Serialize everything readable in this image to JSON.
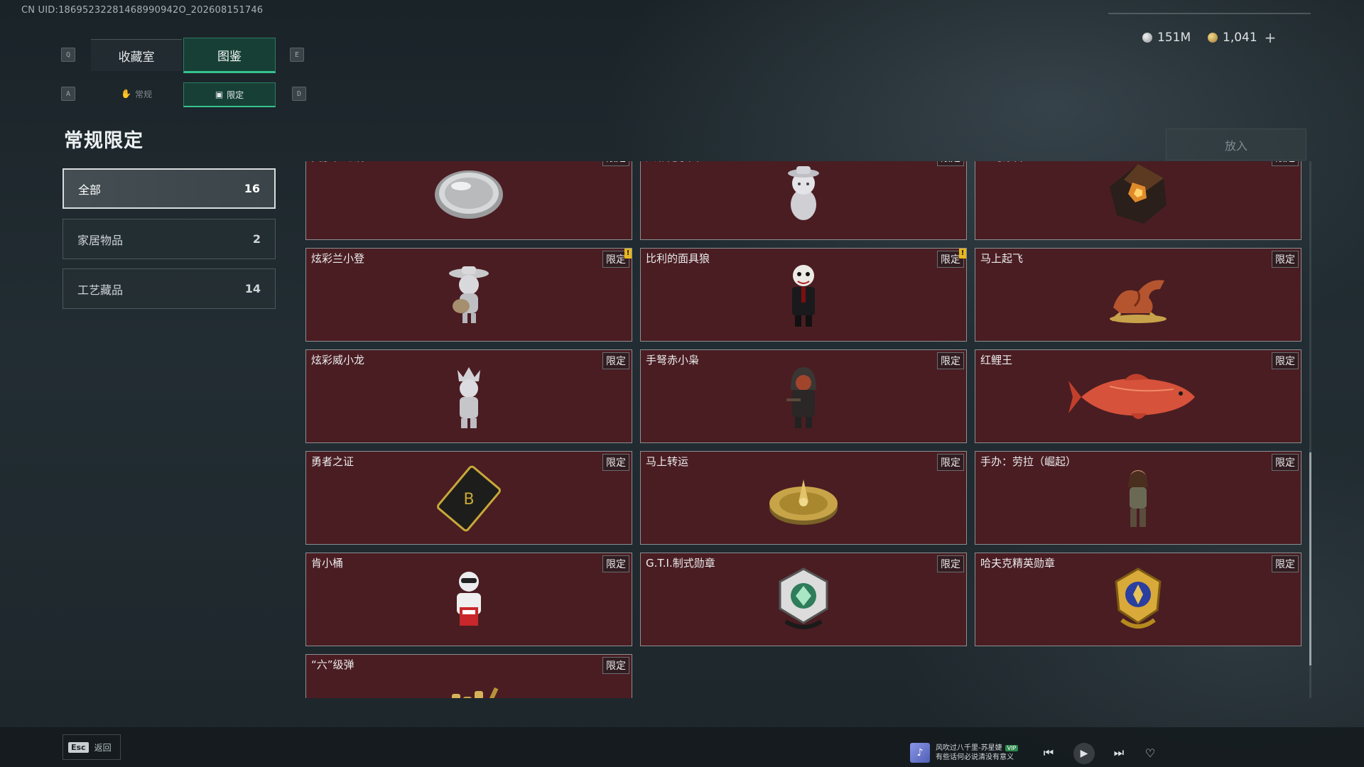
{
  "uid": "CN UID:18695232281468990942O_202608151746",
  "currency": {
    "silver": "151M",
    "gold": "1,041",
    "plus": "+"
  },
  "keys": {
    "prev_tab": "Q",
    "next_tab": "E",
    "prev_sub": "A",
    "next_sub": "D"
  },
  "tabs": [
    {
      "label": "收藏室"
    },
    {
      "label": "图鉴"
    }
  ],
  "subtabs": [
    {
      "label": "常规",
      "icon": "hand-icon"
    },
    {
      "label": "限定",
      "icon": "picture-icon"
    }
  ],
  "page_title": "常规限定",
  "put_button": "放入",
  "filters": [
    {
      "label": "全部",
      "count": "16"
    },
    {
      "label": "家居物品",
      "count": "2"
    },
    {
      "label": "工艺藏品",
      "count": "14"
    }
  ],
  "items": [
    {
      "name": "美彦祖之镜",
      "tag": "限定",
      "art": "mirror"
    },
    {
      "name": "炫彩兔小圈",
      "tag": "限定",
      "art": "bunny"
    },
    {
      "name": "至纯源石",
      "tag": "限定",
      "art": "stone"
    },
    {
      "name": "炫彩兰小登",
      "tag": "限定",
      "art": "guitar",
      "new": "!"
    },
    {
      "name": "比利的面具狼",
      "tag": "限定",
      "art": "puppet",
      "new": "!"
    },
    {
      "name": "马上起飞",
      "tag": "限定",
      "art": "horse"
    },
    {
      "name": "炫彩威小龙",
      "tag": "限定",
      "art": "crown"
    },
    {
      "name": "手弩赤小枭",
      "tag": "限定",
      "art": "hooded"
    },
    {
      "name": "红鲤王",
      "tag": "限定",
      "art": "carp"
    },
    {
      "name": "勇者之证",
      "tag": "限定",
      "art": "card"
    },
    {
      "name": "马上转运",
      "tag": "限定",
      "art": "disc"
    },
    {
      "name": "手办：劳拉（崛起）",
      "tag": "限定",
      "art": "lara"
    },
    {
      "name": "肯小桶",
      "tag": "限定",
      "art": "colonel"
    },
    {
      "name": "G.T.I.制式勋章",
      "tag": "限定",
      "art": "gti"
    },
    {
      "name": "哈夫克精英勋章",
      "tag": "限定",
      "art": "haf"
    },
    {
      "name": "“六”级弹",
      "tag": "限定",
      "art": "bullets"
    }
  ],
  "footer": {
    "esc_key": "Esc",
    "esc_label": "返回"
  },
  "music": {
    "line1": "风吹过八千里-苏星婕",
    "vip": "VIP",
    "line2": "有些话何必说清没有意义"
  },
  "colors": {
    "accent": "#36c38f",
    "card_bg": "#4a1d22",
    "new_badge": "#e8b71d"
  }
}
